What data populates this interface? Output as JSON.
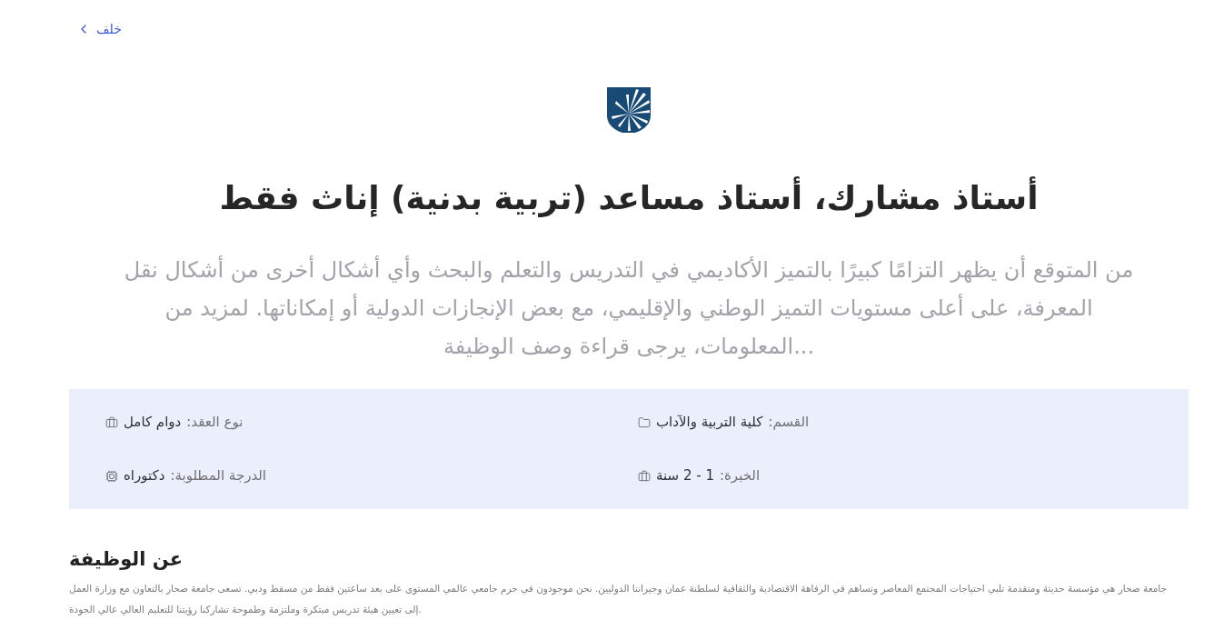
{
  "back_link": {
    "label": "خلف"
  },
  "title": "أستاذ مشارك، أستاذ مساعد (تربية بدنية) إناث فقط",
  "description": "من المتوقع أن يظهر التزامًا كبيرًا بالتميز الأكاديمي في التدريس والتعلم والبحث وأي أشكال أخرى من أشكال نقل المعرفة، على أعلى مستويات التميز الوطني والإقليمي، مع بعض الإنجازات الدولية أو إمكاناتها. لمزيد من المعلومات، يرجى قراءة وصف الوظيفة...",
  "details": [
    {
      "kind": "department",
      "label": "القسم:",
      "value": "كلية التربية والآداب"
    },
    {
      "kind": "contract",
      "label": "نوع العقد:",
      "value": "دوام كامل"
    },
    {
      "kind": "experience",
      "label": "الخبرة:",
      "value": "1 - 2 سنة"
    },
    {
      "kind": "degree",
      "label": "الدرجة المطلوبة:",
      "value": "دكتوراه"
    }
  ],
  "about": {
    "heading": "عن الوظيفة",
    "text": "جامعة صحار هي مؤسسة حديثة ومتقدمة تلبي احتياجات المجتمع المعاصر وتساهم في الرفاهة الاقتصادية والثقافية لسلطنة عمان وجيراننا الدوليين. نحن موجودون في حرم جامعي عالمي المستوى على بعد ساعتين فقط من مسقط ودبي. تسعى جامعة صحار بالتعاون مع وزارة العمل إلى تعيين هيئة تدريس مبتكرة وملتزمة وطموحة تشاركنا رؤيتنا للتعليم العالي عالي الجودة."
  }
}
